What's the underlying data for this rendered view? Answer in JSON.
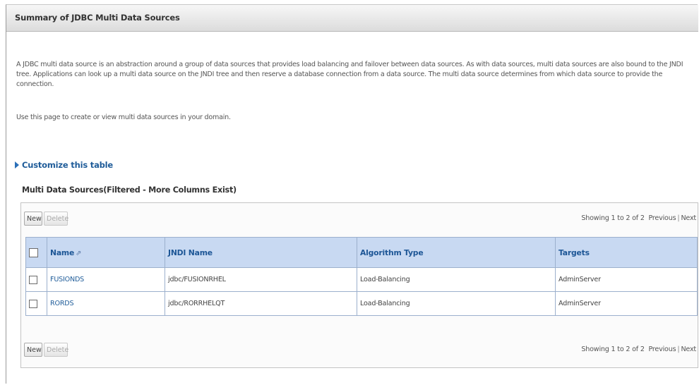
{
  "page": {
    "title": "Summary of JDBC Multi Data Sources",
    "description": "A JDBC multi data source is an abstraction around a group of data sources that provides load balancing and failover between data sources. As with data sources, multi data sources are also bound to the JNDI tree. Applications can look up a multi data source on the JNDI tree and then reserve a database connection from a data source. The multi data source determines from which data source to provide the connection.",
    "use_text": "Use this page to create or view multi data sources in your domain.",
    "customize_link": "Customize this table"
  },
  "table": {
    "caption": "Multi Data Sources(Filtered - More Columns Exist)",
    "new_label": "New",
    "delete_label": "Delete",
    "paging_text": "Showing 1 to 2 of 2",
    "previous_label": "Previous",
    "next_label": "Next",
    "columns": [
      "Name",
      "JNDI Name",
      "Algorithm Type",
      "Targets"
    ],
    "rows": [
      {
        "name": "FUSIONDS",
        "jndi": "jdbc/FUSIONRHEL",
        "algorithm": "Load-Balancing",
        "targets": "AdminServer"
      },
      {
        "name": "RORDS",
        "jndi": "jdbc/RORRHELQT",
        "algorithm": "Load-Balancing",
        "targets": "AdminServer"
      }
    ]
  },
  "icons": {
    "customize": "expand-triangle-icon",
    "sort": "sort-ascending-icon",
    "checkbox": "checkbox-icon"
  },
  "colors": {
    "header_bg": "#c8d9f2",
    "header_text": "#1d5696",
    "link": "#1f5c99",
    "grid_border": "#9cb0cd"
  }
}
